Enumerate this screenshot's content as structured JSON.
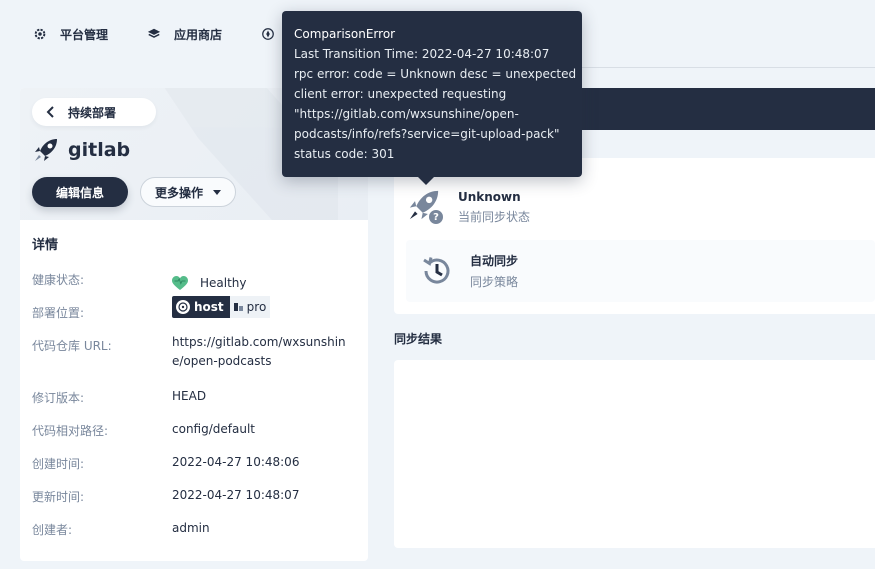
{
  "nav": {
    "items": [
      {
        "label": "平台管理",
        "icon": "gear-icon"
      },
      {
        "label": "应用商店",
        "icon": "stack-icon"
      },
      {
        "label": "",
        "icon": "compass-icon"
      }
    ]
  },
  "app": {
    "back_label": "持续部署",
    "name": "gitlab",
    "edit_label": "编辑信息",
    "more_label": "更多操作"
  },
  "details": {
    "title": "详情",
    "health_label": "健康状态:",
    "health_value": "Healthy",
    "location_label": "部署位置:",
    "location_cluster": "host",
    "location_namespace": "pro",
    "repo_label": "代码仓库 URL:",
    "repo_value": "https://gitlab.com/wxsunshine/open-podcasts",
    "revision_label": "修订版本:",
    "revision_value": "HEAD",
    "path_label": "代码相对路径:",
    "path_value": "config/default",
    "created_label": "创建时间:",
    "created_value": "2022-04-27 10:48:06",
    "updated_label": "更新时间:",
    "updated_value": "2022-04-27 10:48:07",
    "creator_label": "创建者:",
    "creator_value": "admin"
  },
  "status": {
    "sync_status_value": "Unknown",
    "sync_status_label": "当前同步状态",
    "policy_value": "自动同步",
    "policy_label": "同步策略"
  },
  "sync_result": {
    "title": "同步结果"
  },
  "tooltip": {
    "title": "ComparisonError",
    "lines": [
      "Last Transition Time:  2022-04-27 10:48:07",
      "rpc error: code = Unknown desc = unexpected",
      "client error: unexpected requesting",
      "\"https://gitlab.com/wxsunshine/open-",
      "podcasts/info/refs?service=git-upload-pack\"",
      "status code: 301"
    ]
  },
  "colors": {
    "primary_dark": "#242e42",
    "healthy_green": "#55bc8a",
    "muted_text": "#79879c",
    "page_bg": "#eff4f9"
  }
}
